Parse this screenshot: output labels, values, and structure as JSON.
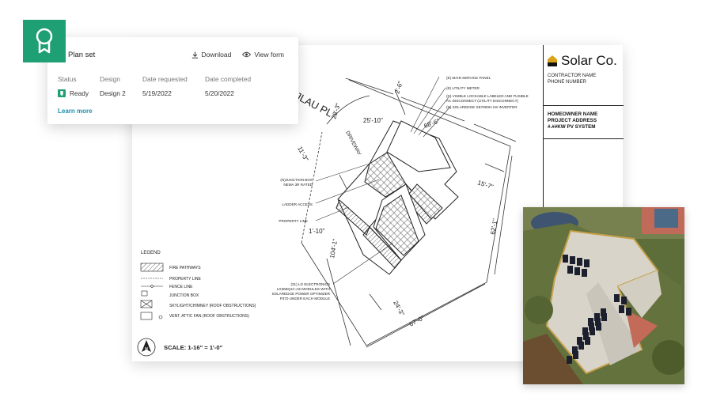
{
  "card": {
    "title": "Plan set",
    "download": "Download",
    "view_form": "View form",
    "columns": {
      "status": {
        "header": "Status",
        "value": "Ready"
      },
      "design": {
        "header": "Design",
        "value": "Design 2"
      },
      "requested": {
        "header": "Date requested",
        "value": "5/19/2022"
      },
      "completed": {
        "header": "Date completed",
        "value": "5/20/2022"
      }
    },
    "learn_more": "Learn more"
  },
  "titleblock": {
    "brand": "Solar Co.",
    "contractor": "CONTRACTOR NAME",
    "phone": "PHONE NUMBER",
    "homeowner": "HOMEOWNER NAME",
    "address": "PROJECT ADDRESS",
    "system": "#.##KW PV SYSTEM"
  },
  "drawing": {
    "street": "JLAU PL",
    "driveway": "DRIVEWAY",
    "scale": "SCALE: 1-16\" = 1'-0\"",
    "north": "N",
    "dims": {
      "d1": "2'-6\"",
      "d2": "25'-10\"",
      "d3": "68'-6\"",
      "d4": "28'-3\"",
      "d5": "11'-3\"",
      "d6": "15'-7\"",
      "d7": "62'-1\"",
      "d8": "1'-10\"",
      "d9": "104'-1\"",
      "d10": "24'-3\"",
      "d11": "67'-0\""
    },
    "callouts": {
      "c1": "(E) MAIN SERVICE PANEL",
      "c2": "(E) UTILITY METER",
      "c3a": "(N) VISIBLE LOCKABLE LABELED AND FUSIBLE",
      "c3b": "AC DISCONNECT (UTILITY DISCONNECT)",
      "c4": "(N) SOLAREDGE SE7600H-US INVERTER",
      "c5a": "(N)JUNCTION BOX",
      "c5b": "NEMA 3R RATED",
      "c6": "LADDER ACCESS",
      "c7": "PROPERTY LINE",
      "c8a": "(31) LG ELECTRONICS",
      "c8b": "LG365Q1C-A5 MODULES WITH",
      "c8c": "SOLAREDGE POWER OPTIMIZER",
      "c8d": "P370 UNDER EACH MODULE"
    },
    "legend": {
      "title": "LEGEND",
      "items": [
        "FIRE PATHWAYS",
        "PROPERTY LINE",
        "FENCE LINE",
        "JUNCTION BOX",
        "SKYLIGHT/CHIMNEY (ROOF OBSTRUCTIONS)",
        "VENT, ATTIC FAN (ROOF OBSTRUCTIONS)"
      ]
    }
  },
  "colors": {
    "accent": "#1f9f74",
    "link": "#1b8faa",
    "logo_gold": "#d9a21b"
  },
  "icons": {
    "award": "award-ribbon-icon",
    "download": "download-icon",
    "view": "eye-icon",
    "ready": "ready-badge-icon",
    "north": "north-arrow-icon"
  }
}
